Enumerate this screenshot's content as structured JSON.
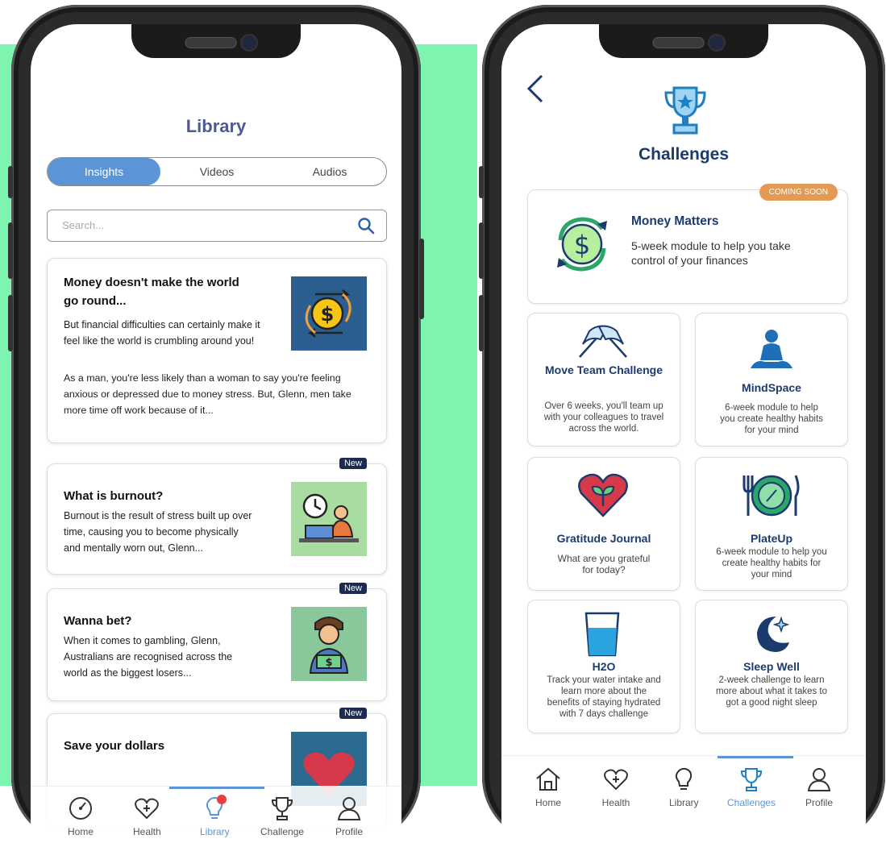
{
  "left": {
    "title": "Library",
    "tabs": [
      "Insights",
      "Videos",
      "Audios"
    ],
    "search_placeholder": "Search...",
    "articles": [
      {
        "title_line1": "Money doesn't make the world",
        "title_line2": "go round...",
        "intro_line1": "But financial difficulties can certainly make it",
        "intro_line2": "feel like the world is crumbling around you!",
        "body_line1": "As a man, you're less likely than a woman to say you're feeling",
        "body_line2": "anxious or depressed due to money stress. But, Glenn, men take",
        "body_line3": "more time off work because of it..."
      },
      {
        "badge": "New",
        "title": "What is burnout?",
        "body_line1": "Burnout is the result of stress built up over",
        "body_line2": "time, causing you to become physically",
        "body_line3": "and mentally worn out, Glenn..."
      },
      {
        "badge": "New",
        "title": "Wanna bet?",
        "body_line1": "When it comes to gambling, Glenn,",
        "body_line2": "Australians are recognised across the",
        "body_line3": "world as the biggest losers..."
      },
      {
        "badge": "New",
        "title": "Save your dollars"
      }
    ],
    "tabbar": [
      "Home",
      "Health",
      "Library",
      "Challenge",
      "Profile"
    ]
  },
  "right": {
    "title": "Challenges",
    "featured": {
      "badge": "COMING SOON",
      "title": "Money Matters",
      "desc_line1": "5-week module to help you take",
      "desc_line2": "control of your finances"
    },
    "cards": [
      {
        "title": "Move Team Challenge",
        "d1": "Over 6 weeks, you'll team up",
        "d2": "with your colleagues to travel",
        "d3": "across the world."
      },
      {
        "title": "MindSpace",
        "d1": "6-week module to help",
        "d2": "you create healthy habits",
        "d3": "for your mind"
      },
      {
        "title": "Gratitude Journal",
        "d1": "What are you grateful",
        "d2": "for today?",
        "d3": ""
      },
      {
        "title": "PlateUp",
        "d1": "6-week module to help you",
        "d2": "create healthy habits for",
        "d3": "your mind"
      },
      {
        "title": "H2O",
        "d1": "Track your water intake and",
        "d2": "learn more about the",
        "d3": "benefits of staying hydrated",
        "d4": "with 7 days challenge"
      },
      {
        "title": "Sleep Well",
        "d1": "2-week challenge to learn",
        "d2": "more about what it takes to",
        "d3": "got a good night sleep"
      }
    ],
    "tabbar": [
      "Home",
      "Health",
      "Library",
      "Challenges",
      "Profile"
    ]
  },
  "colors": {
    "background_green": "#7ef6b1",
    "accent_blue": "#5c95d6",
    "navy": "#1b3b6f",
    "badge_orange": "#e29a55"
  }
}
